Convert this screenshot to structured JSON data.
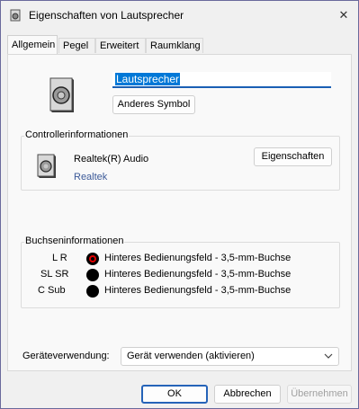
{
  "window": {
    "title": "Eigenschaften von Lautsprecher",
    "close_glyph": "✕"
  },
  "tabs": [
    {
      "label": "Allgemein",
      "active": true
    },
    {
      "label": "Pegel",
      "active": false
    },
    {
      "label": "Erweitert",
      "active": false
    },
    {
      "label": "Raumklang",
      "active": false
    }
  ],
  "device": {
    "name_value": "Lautsprecher",
    "change_icon_label": "Anderes Symbol",
    "icon": "speaker-icon"
  },
  "controller": {
    "title": "Controllerinformationen",
    "name": "Realtek(R) Audio",
    "vendor_link": "Realtek",
    "properties_button": "Eigenschaften",
    "icon": "speaker-icon"
  },
  "jacks": {
    "title": "Buchseninformationen",
    "rows": [
      {
        "label": "L R",
        "color": "#e00000",
        "text": "Hinteres Bedienungsfeld - 3,5-mm-Buchse"
      },
      {
        "label": "SL SR",
        "color": "#000000",
        "text": "Hinteres Bedienungsfeld - 3,5-mm-Buchse"
      },
      {
        "label": "C Sub",
        "color": "#000000",
        "text": "Hinteres Bedienungsfeld - 3,5-mm-Buchse"
      }
    ]
  },
  "usage": {
    "label": "Geräteverwendung:",
    "selected": "Gerät verwenden (aktivieren)"
  },
  "footer": {
    "ok": "OK",
    "cancel": "Abbrechen",
    "apply": "Übernehmen"
  },
  "colors": {
    "accent": "#1a5fb4",
    "link": "#3b5998",
    "selection": "#0078d7"
  }
}
